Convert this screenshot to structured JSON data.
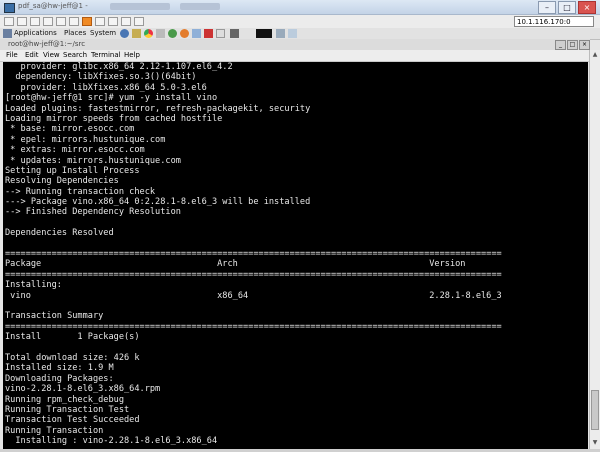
{
  "vnc_window": {
    "title": "pdf_sa@hw-jeff@1 -",
    "address": "10.1.116.170:0"
  },
  "top_panel": {
    "applications": "Applications",
    "places": "Places",
    "system": "System"
  },
  "terminal_window": {
    "title": "root@hw-jeff@1:~/src"
  },
  "menu": [
    "File",
    "Edit",
    "View",
    "Search",
    "Terminal",
    "Help"
  ],
  "terminal": {
    "lines": [
      "   provider: glibc.x86_64 2.12-1.107.el6_4.2",
      "  dependency: libXfixes.so.3()(64bit)",
      "   provider: libXfixes.x86_64 5.0-3.el6",
      "[root@hw-jeff@1 src]# yum -y install vino",
      "Loaded plugins: fastestmirror, refresh-packagekit, security",
      "Loading mirror speeds from cached hostfile",
      " * base: mirror.esocc.com",
      " * epel: mirrors.hustunique.com",
      " * extras: mirror.esocc.com",
      " * updates: mirrors.hustunique.com",
      "Setting up Install Process",
      "Resolving Dependencies",
      "--> Running transaction check",
      "---> Package vino.x86_64 0:2.28.1-8.el6_3 will be installed",
      "--> Finished Dependency Resolution",
      "",
      "Dependencies Resolved",
      "",
      "================================================================================================",
      "Package                                  Arch                                     Version",
      "================================================================================================",
      "Installing:",
      " vino                                    x86_64                                   2.28.1-8.el6_3",
      "",
      "Transaction Summary",
      "================================================================================================",
      "Install       1 Package(s)",
      "",
      "Total download size: 426 k",
      "Installed size: 1.9 M",
      "Downloading Packages:",
      "vino-2.28.1-8.el6_3.x86_64.rpm",
      "Running rpm_check_debug",
      "Running Transaction Test",
      "Transaction Test Succeeded",
      "Running Transaction",
      "  Installing : vino-2.28.1-8.el6_3.x86_64"
    ]
  }
}
